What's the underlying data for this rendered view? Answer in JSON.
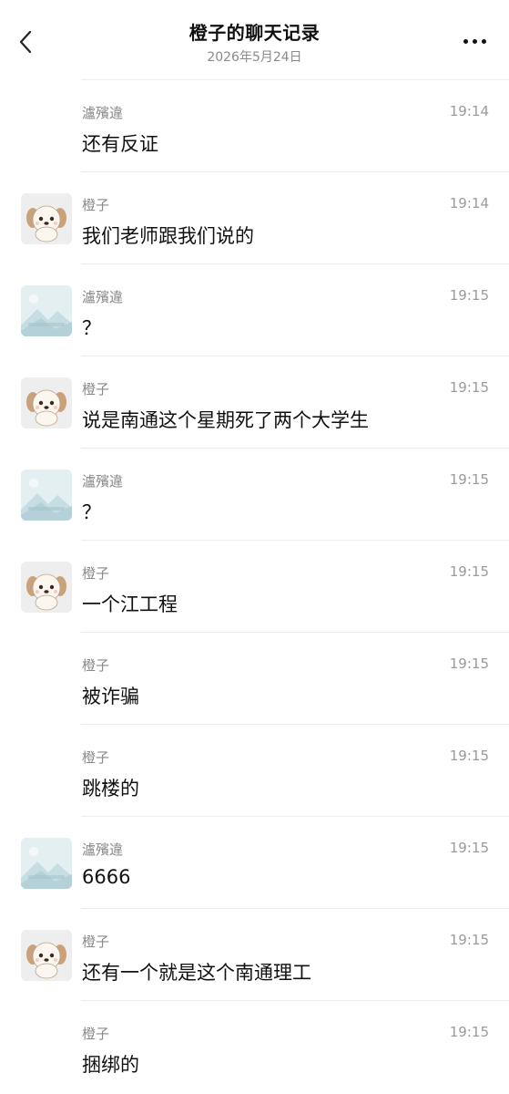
{
  "header": {
    "title": "橙子的聊天记录",
    "date": "2026年5月24日"
  },
  "messages": [
    {
      "sender": "瀘殯違",
      "time": "19:14",
      "text": "还有反证",
      "avatar": "none"
    },
    {
      "sender": "橙子",
      "time": "19:14",
      "text": "我们老师跟我们说的",
      "avatar": "dog"
    },
    {
      "sender": "瀘殯違",
      "time": "19:15",
      "text": "？",
      "avatar": "landscape"
    },
    {
      "sender": "橙子",
      "time": "19:15",
      "text": "说是南通这个星期死了两个大学生",
      "avatar": "dog"
    },
    {
      "sender": "瀘殯違",
      "time": "19:15",
      "text": "？",
      "avatar": "landscape"
    },
    {
      "sender": "橙子",
      "time": "19:15",
      "text": "一个江工程",
      "avatar": "dog"
    },
    {
      "sender": "橙子",
      "time": "19:15",
      "text": "被诈骗",
      "avatar": "none"
    },
    {
      "sender": "橙子",
      "time": "19:15",
      "text": "跳楼的",
      "avatar": "none"
    },
    {
      "sender": "瀘殯違",
      "time": "19:15",
      "text": "6666",
      "avatar": "landscape"
    },
    {
      "sender": "橙子",
      "time": "19:15",
      "text": "还有一个就是这个南通理工",
      "avatar": "dog"
    },
    {
      "sender": "橙子",
      "time": "19:15",
      "text": "捆绑的",
      "avatar": "none"
    }
  ]
}
